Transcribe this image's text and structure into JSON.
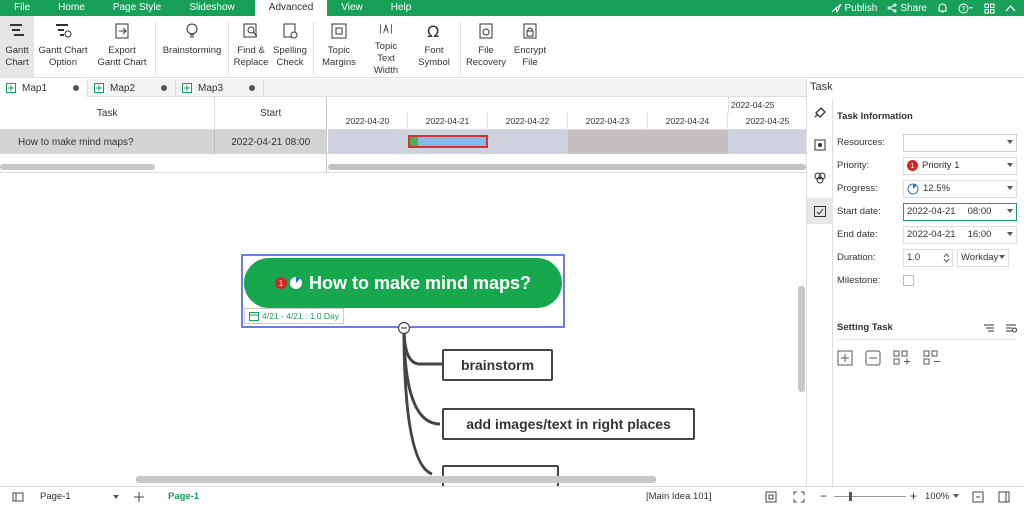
{
  "menu": {
    "items": [
      "File",
      "Home",
      "Page Style",
      "Slideshow",
      "Advanced",
      "View",
      "Help"
    ],
    "publish": "Publish",
    "share": "Share"
  },
  "ribbon": {
    "buttons": [
      {
        "label": "Gantt Chart",
        "icon": "gantt-chart-icon"
      },
      {
        "label": "Gantt Chart Option",
        "icon": "gantt-option-icon"
      },
      {
        "label": "Export Gantt Chart",
        "icon": "export-icon"
      },
      {
        "label": "Brainstorming",
        "icon": "lightbulb-icon"
      },
      {
        "label": "Find & Replace",
        "icon": "find-replace-icon"
      },
      {
        "label": "Spelling Check",
        "icon": "spelling-check-icon"
      },
      {
        "label": "Topic Margins",
        "icon": "topic-margins-icon"
      },
      {
        "label": "Topic Text Width",
        "icon": "text-width-icon"
      },
      {
        "label": "Font Symbol",
        "icon": "omega-icon"
      },
      {
        "label": "File Recovery",
        "icon": "file-recovery-icon"
      },
      {
        "label": "Encrypt File",
        "icon": "encrypt-file-icon"
      }
    ]
  },
  "doc_tabs": [
    "Map1",
    "Map2",
    "Map3"
  ],
  "gantt": {
    "col_task": "Task",
    "col_start": "Start",
    "row_task": "How to make mind maps?",
    "row_start": "2022-04-21 08:00",
    "top_date": "2022-04-25",
    "dates": [
      "2022-04-20",
      "2022-04-21",
      "2022-04-22",
      "2022-04-23",
      "2022-04-24",
      "2022-04-25"
    ]
  },
  "mindmap": {
    "main_topic": "How to make mind maps?",
    "priority_badge": "1",
    "task_info": "4/21 - 4/21 : 1.0 Day",
    "subtopics": [
      "brainstorm",
      "add images/text in right places"
    ]
  },
  "panel": {
    "title": "Task",
    "task_information": "Task Information",
    "resources_label": "Resources:",
    "resources_value": "",
    "priority_label": "Priority:",
    "priority_value": "Priority 1",
    "priority_badge": "1",
    "progress_label": "Progress:",
    "progress_value": "12.5%",
    "start_label": "Start date:",
    "start_date": "2022-04-21",
    "start_time": "08:00",
    "end_label": "End date:",
    "end_date": "2022-04-21",
    "end_time": "16:00",
    "duration_label": "Duration:",
    "duration_value": "1.0",
    "duration_unit": "Workday",
    "milestone_label": "Milestone:",
    "setting_task": "Setting Task"
  },
  "status": {
    "page_select": "Page-1",
    "page_tab": "Page-1",
    "main_idea": "[Main Idea 101]",
    "zoom": "100%"
  },
  "colors": {
    "brand": "#18a058",
    "topic": "#17a84e",
    "gantt_bar": "#85b9e8",
    "selection": "#4a6fd8"
  }
}
